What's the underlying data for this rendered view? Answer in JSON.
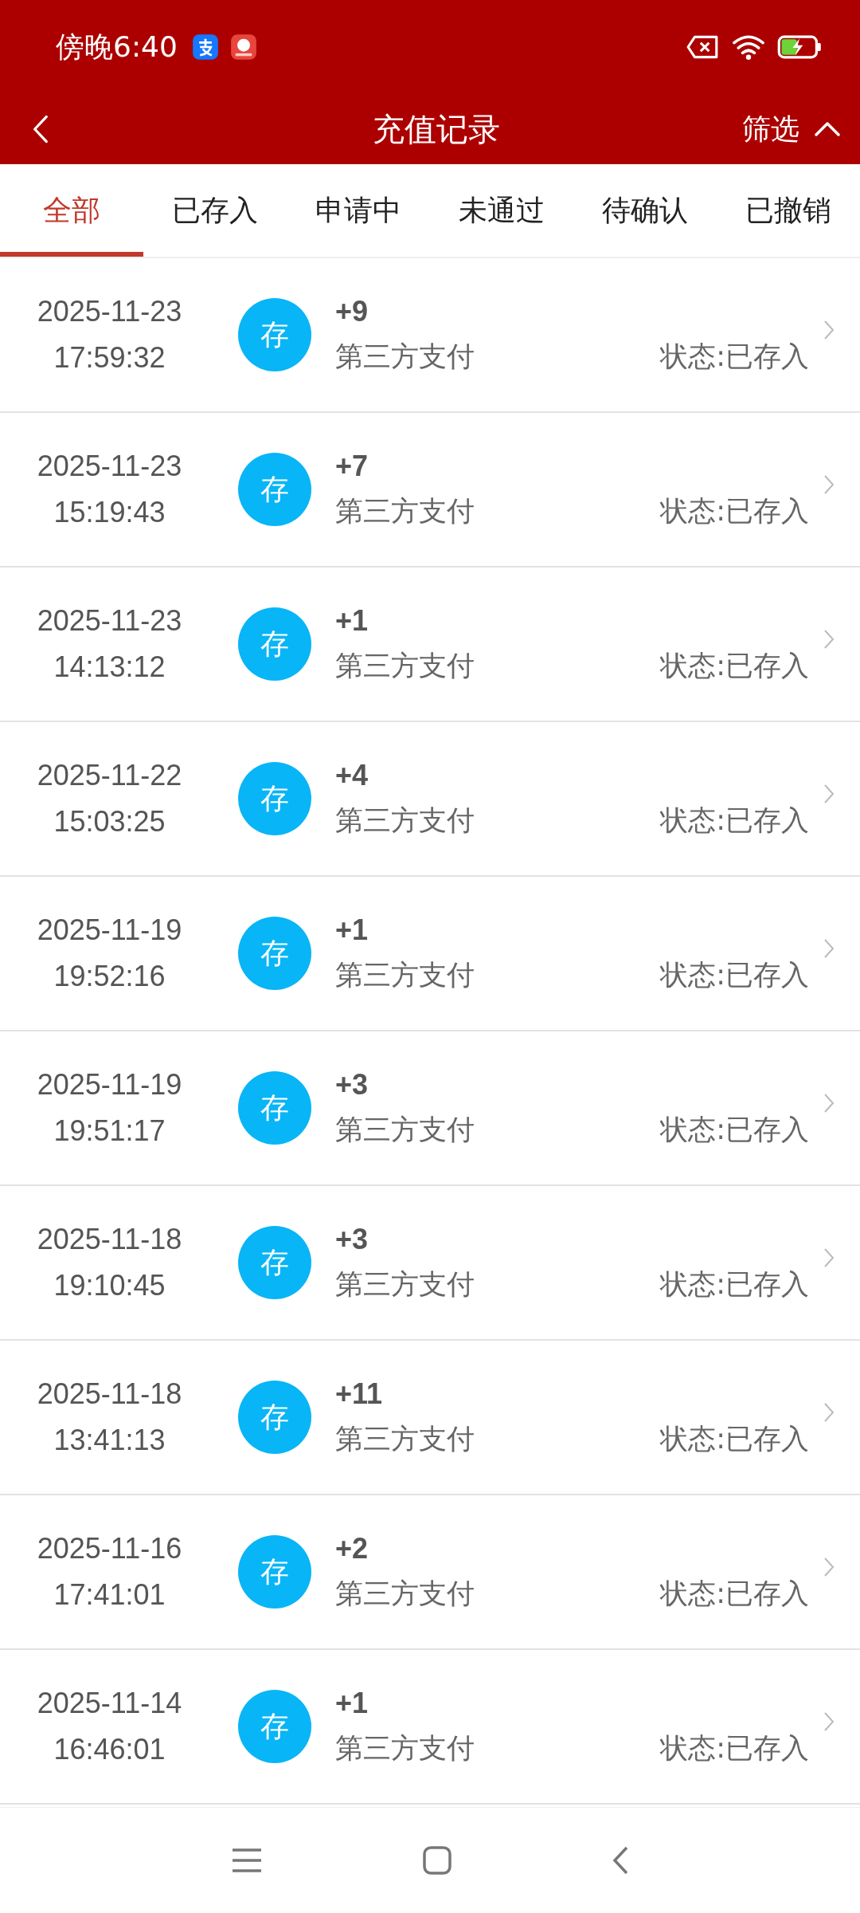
{
  "status_bar": {
    "time": "傍晚6:40"
  },
  "header": {
    "title": "充值记录",
    "filter": "筛选"
  },
  "tabs": [
    {
      "label": "全部",
      "selected": true
    },
    {
      "label": "已存入",
      "selected": false
    },
    {
      "label": "申请中",
      "selected": false
    },
    {
      "label": "未通过",
      "selected": false
    },
    {
      "label": "待确认",
      "selected": false
    },
    {
      "label": "已撤销",
      "selected": false
    }
  ],
  "records": [
    {
      "date": "2025-11-23",
      "time": "17:59:32",
      "badge": "存",
      "amount": "+9",
      "method": "第三方支付",
      "status": "状态:已存入"
    },
    {
      "date": "2025-11-23",
      "time": "15:19:43",
      "badge": "存",
      "amount": "+7",
      "method": "第三方支付",
      "status": "状态:已存入"
    },
    {
      "date": "2025-11-23",
      "time": "14:13:12",
      "badge": "存",
      "amount": "+1",
      "method": "第三方支付",
      "status": "状态:已存入"
    },
    {
      "date": "2025-11-22",
      "time": "15:03:25",
      "badge": "存",
      "amount": "+4",
      "method": "第三方支付",
      "status": "状态:已存入"
    },
    {
      "date": "2025-11-19",
      "time": "19:52:16",
      "badge": "存",
      "amount": "+1",
      "method": "第三方支付",
      "status": "状态:已存入"
    },
    {
      "date": "2025-11-19",
      "time": "19:51:17",
      "badge": "存",
      "amount": "+3",
      "method": "第三方支付",
      "status": "状态:已存入"
    },
    {
      "date": "2025-11-18",
      "time": "19:10:45",
      "badge": "存",
      "amount": "+3",
      "method": "第三方支付",
      "status": "状态:已存入"
    },
    {
      "date": "2025-11-18",
      "time": "13:41:13",
      "badge": "存",
      "amount": "+11",
      "method": "第三方支付",
      "status": "状态:已存入"
    },
    {
      "date": "2025-11-16",
      "time": "17:41:01",
      "badge": "存",
      "amount": "+2",
      "method": "第三方支付",
      "status": "状态:已存入"
    },
    {
      "date": "2025-11-14",
      "time": "16:46:01",
      "badge": "存",
      "amount": "+1",
      "method": "第三方支付",
      "status": "状态:已存入"
    }
  ]
}
